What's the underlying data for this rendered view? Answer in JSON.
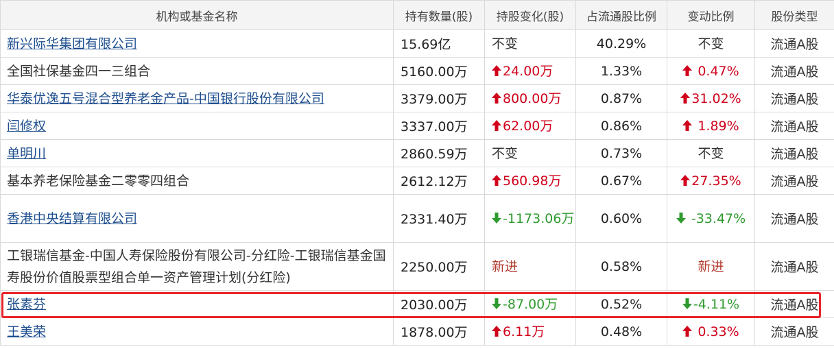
{
  "headers": {
    "name": "机构或基金名称",
    "qty": "持有数量(股)",
    "change": "持股变化(股)",
    "ratio": "占流通股比例",
    "change_ratio": "变动比例",
    "type": "股份类型"
  },
  "rows": [
    {
      "name": "新兴际华集团有限公司",
      "link": true,
      "qty": "15.69亿",
      "change": "不变",
      "dir": "same",
      "ratio": "40.29%",
      "change_ratio": "不变",
      "type": "流通A股"
    },
    {
      "name": "全国社保基金四一三组合",
      "link": false,
      "qty": "5160.00万",
      "change": "24.00万",
      "dir": "up",
      "ratio": "1.33%",
      "change_ratio": " 0.47%",
      "type": "流通A股"
    },
    {
      "name": "华泰优逸五号混合型养老金产品-中国银行股份有限公司",
      "link": true,
      "qty": "3379.00万",
      "change": "800.00万",
      "dir": "up",
      "ratio": "0.87%",
      "change_ratio": "31.02%",
      "type": "流通A股"
    },
    {
      "name": "闫修权",
      "link": true,
      "qty": "3337.00万",
      "change": "62.00万",
      "dir": "up",
      "ratio": "0.86%",
      "change_ratio": " 1.89%",
      "type": "流通A股"
    },
    {
      "name": "单明川",
      "link": true,
      "qty": "2860.59万",
      "change": "不变",
      "dir": "same",
      "ratio": "0.73%",
      "change_ratio": "不变",
      "type": "流通A股"
    },
    {
      "name": "基本养老保险基金二零零四组合",
      "link": false,
      "qty": "2612.12万",
      "change": "560.98万",
      "dir": "up",
      "ratio": "0.67%",
      "change_ratio": "27.35%",
      "type": "流通A股"
    },
    {
      "name": "香港中央结算有限公司",
      "link": true,
      "qty": "2331.40万",
      "change": "-1173.06万",
      "dir": "down",
      "ratio": "0.60%",
      "change_ratio": " -33.47%",
      "type": "流通A股"
    },
    {
      "name": "工银瑞信基金-中国人寿保险股份有限公司-分红险-工银瑞信基金国寿股份价值股票型组合单一资产管理计划(分红险)",
      "link": false,
      "qty": "2250.00万",
      "change": "新进",
      "dir": "new",
      "ratio": "0.58%",
      "change_ratio": "新进",
      "type": "流通A股"
    },
    {
      "name": "张素芬",
      "link": true,
      "qty": "2030.00万",
      "change": "-87.00万",
      "dir": "down",
      "ratio": "0.52%",
      "change_ratio": "-4.11%",
      "type": "流通A股",
      "highlighted": true
    },
    {
      "name": "王美荣",
      "link": true,
      "qty": "1878.00万",
      "change": "6.11万",
      "dir": "up",
      "ratio": "0.48%",
      "change_ratio": " 0.33%",
      "type": "流通A股"
    }
  ],
  "colors": {
    "up": "#d0021b",
    "down": "#2e9b2e",
    "link": "#1f4f8f",
    "highlight": "#e8242b"
  }
}
